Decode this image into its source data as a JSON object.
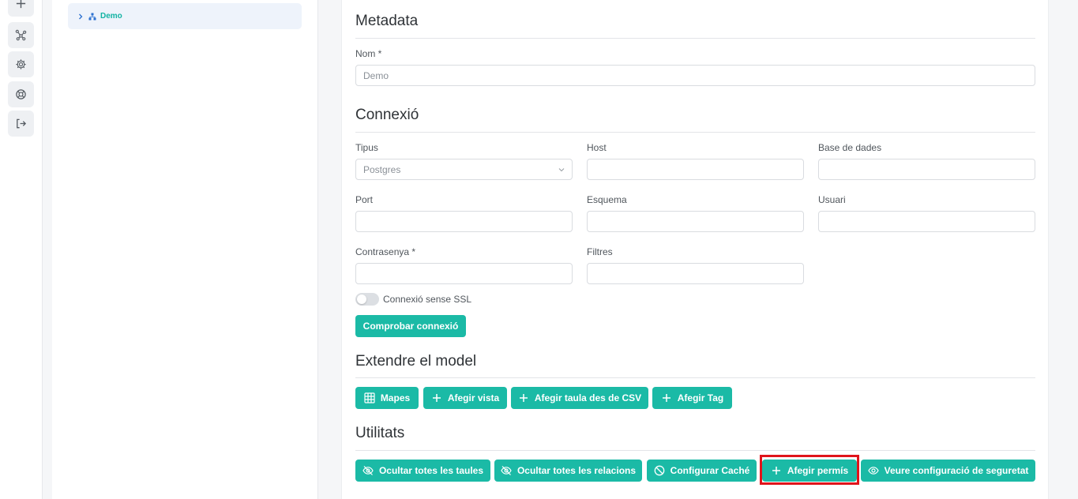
{
  "rail": {
    "icons": [
      "plus-icon",
      "network-icon",
      "gear-icon",
      "lifebuoy-icon",
      "logout-icon"
    ]
  },
  "tree": {
    "node_label": "Demo"
  },
  "metadata": {
    "title": "Metadata",
    "name_label": "Nom *",
    "name_value": "Demo"
  },
  "connection": {
    "title": "Connexió",
    "type_label": "Tipus",
    "type_value": "Postgres",
    "host_label": "Host",
    "host_value": "",
    "database_label": "Base de dades",
    "database_value": "",
    "port_label": "Port",
    "port_value": "",
    "schema_label": "Esquema",
    "schema_value": "",
    "user_label": "Usuari",
    "user_value": "",
    "password_label": "Contrasenya *",
    "password_value": "",
    "filters_label": "Filtres",
    "filters_value": "",
    "ssl_toggle_label": "Connexió sense SSL",
    "ssl_toggle_on": false,
    "test_button": "Comprobar connexió"
  },
  "extend": {
    "title": "Extendre el model",
    "maps_button": "Mapes",
    "add_view_button": "Afegir vista",
    "add_csv_button": "Afegir taula des de CSV",
    "add_tag_button": "Afegir Tag"
  },
  "utilities": {
    "title": "Utilitats",
    "hide_tables_button": "Ocultar totes les taules",
    "hide_relations_button": "Ocultar totes les relacions",
    "cache_button": "Configurar Caché",
    "add_permission_button": "Afegir permís",
    "security_button": "Veure configuració de seguretat"
  },
  "colors": {
    "accent": "#1bbaa6",
    "highlight": "#e0141b"
  }
}
